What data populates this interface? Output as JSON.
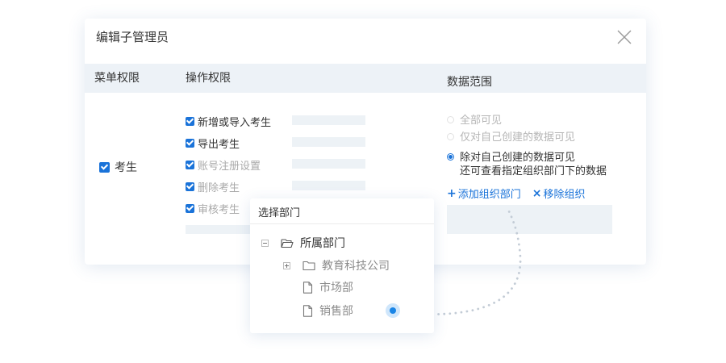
{
  "dialog": {
    "title": "编辑子管理员"
  },
  "columns": {
    "menu": "菜单权限",
    "operation": "操作权限",
    "scope": "数据范围"
  },
  "menu_permission": {
    "label": "考生",
    "checked": true
  },
  "operations": [
    {
      "label": "新增或导入考生",
      "checked": true,
      "disabled": false
    },
    {
      "label": "导出考生",
      "checked": true,
      "disabled": false
    },
    {
      "label": "账号注册设置",
      "checked": true,
      "disabled": true
    },
    {
      "label": "删除考生",
      "checked": true,
      "disabled": true
    },
    {
      "label": "审核考生",
      "checked": true,
      "disabled": true
    }
  ],
  "scope_options": [
    {
      "line1": "全部可见",
      "line2": "",
      "selected": false,
      "disabled": true
    },
    {
      "line1": "仅对自己创建的数据可见",
      "line2": "",
      "selected": false,
      "disabled": true
    },
    {
      "line1": "除对自己创建的数据可见",
      "line2": "还可查看指定组织部门下的数据",
      "selected": true,
      "disabled": false
    }
  ],
  "actions": {
    "add": {
      "icon": "+",
      "label": "添加组织部门"
    },
    "remove": {
      "icon": "×",
      "label": "移除组织"
    }
  },
  "dept_selector": {
    "title": "选择部门",
    "tree": [
      {
        "label": "所属部门",
        "toggle": "collapse",
        "icon": "folder-open-icon"
      },
      {
        "label": "教育科技公司",
        "toggle": "expand",
        "icon": "folder-icon"
      },
      {
        "label": "市场部",
        "toggle": "",
        "icon": "file-icon"
      },
      {
        "label": "销售部",
        "toggle": "",
        "icon": "file-icon"
      }
    ]
  },
  "colors": {
    "accent": "#1a73d9",
    "band": "#edf2f7",
    "disabled_text": "#a9a9a9"
  }
}
